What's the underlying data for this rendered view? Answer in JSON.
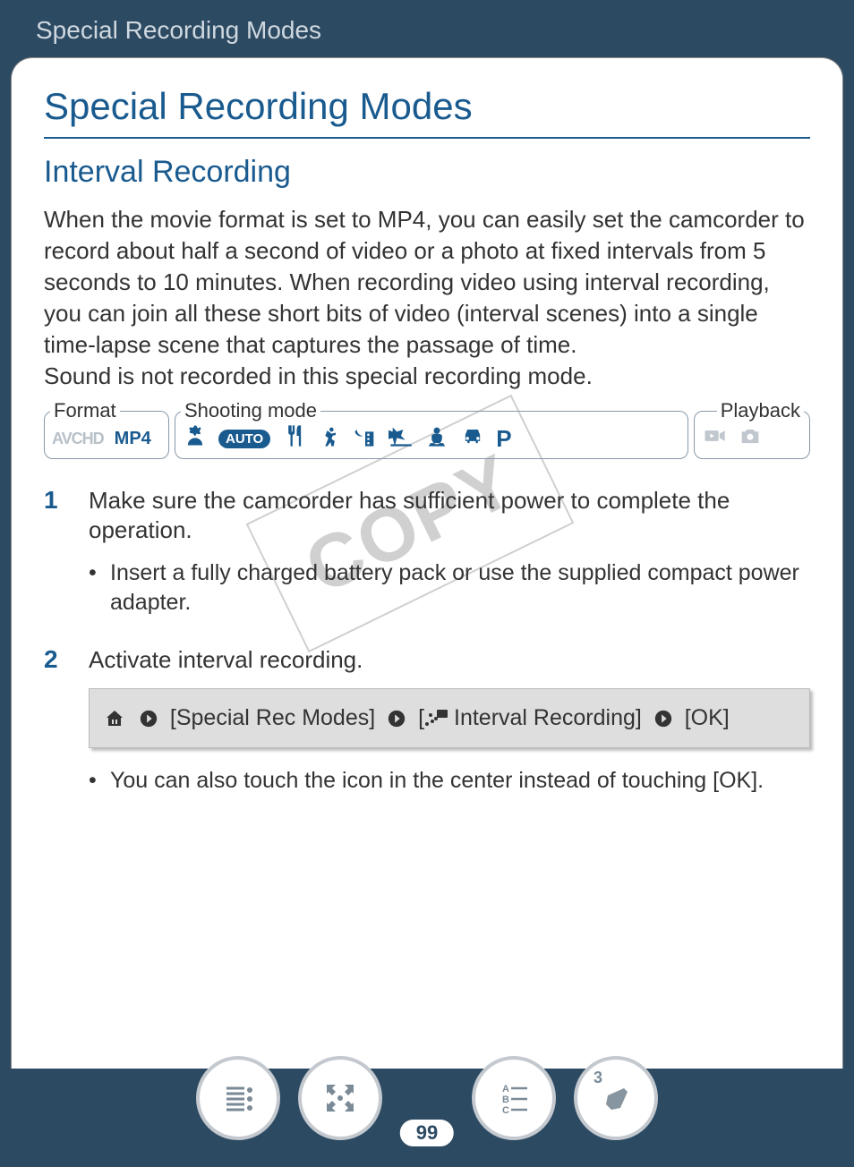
{
  "header": {
    "breadcrumb": "Special Recording Modes"
  },
  "page": {
    "title": "Special Recording Modes",
    "subtitle": "Interval Recording",
    "intro": "When the movie format is set to MP4, you can easily set the camcorder to record about half a second of video or a photo at fixed intervals from 5 seconds to 10 minutes. When recording video using interval recording, you can join all these short bits of video (interval scenes) into a single time-lapse scene that captures the passage of time.",
    "intro2": "Sound is not recorded in this special recording mode.",
    "watermark": "COPY"
  },
  "modes": {
    "format_label": "Format",
    "format_avchd": "AVCHD",
    "format_mp4": "MP4",
    "shoot_label": "Shooting mode",
    "auto_text": "AUTO",
    "p_mode": "P",
    "playback_label": "Playback"
  },
  "steps": [
    {
      "num": "1",
      "title": "Make sure the camcorder has sufficient power to complete the operation.",
      "bullets": [
        "Insert a fully charged battery pack or use the supplied compact power adapter."
      ]
    },
    {
      "num": "2",
      "title": "Activate interval recording.",
      "nav_path": {
        "item1": "[Special Rec Modes]",
        "item2_prefix": "[",
        "item2_text": " Interval Recording]",
        "ok": "[OK]"
      },
      "bullets": [
        "You can also touch the icon in the center instead of touching [OK]."
      ]
    }
  ],
  "footer": {
    "page_number": "99",
    "index_badge": "3"
  }
}
